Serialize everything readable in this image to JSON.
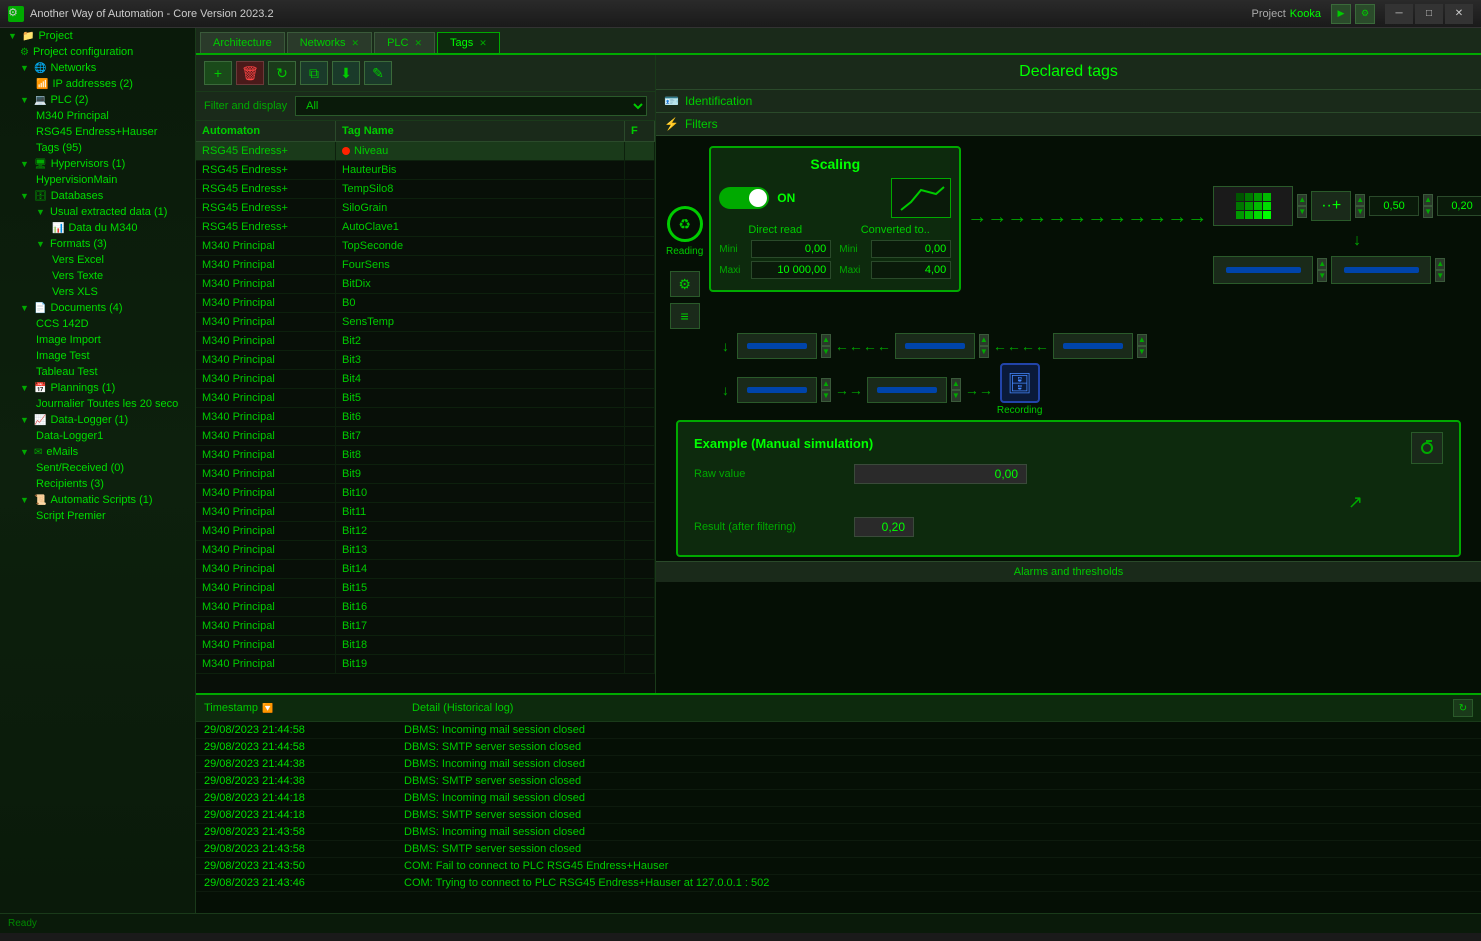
{
  "app": {
    "title": "Another Way of Automation - Core Version 2023.2",
    "project_label": "Project",
    "project_name": "Kooka"
  },
  "tabs": [
    {
      "label": "Architecture",
      "closable": false,
      "active": false
    },
    {
      "label": "Networks",
      "closable": true,
      "active": false
    },
    {
      "label": "PLC",
      "closable": true,
      "active": false
    },
    {
      "label": "Tags",
      "closable": true,
      "active": true
    }
  ],
  "declared_tags": {
    "title": "Declared tags",
    "identification_label": "Identification",
    "filters_label": "Filters",
    "alarms_label": "Alarms and thresholds"
  },
  "filter_bar": {
    "label": "Filter and display",
    "value": "All"
  },
  "tag_table": {
    "headers": [
      "Automaton",
      "Tag Name",
      "F"
    ],
    "rows": [
      {
        "automaton": "RSG45 Endress+",
        "tag_name": "Niveau",
        "flag": "red",
        "selected": true
      },
      {
        "automaton": "RSG45 Endress+",
        "tag_name": "HauteurBis",
        "flag": ""
      },
      {
        "automaton": "RSG45 Endress+",
        "tag_name": "TempSilo8",
        "flag": ""
      },
      {
        "automaton": "RSG45 Endress+",
        "tag_name": "SiloGrain",
        "flag": ""
      },
      {
        "automaton": "RSG45 Endress+",
        "tag_name": "AutoClave1",
        "flag": ""
      },
      {
        "automaton": "M340 Principal",
        "tag_name": "TopSeconde",
        "flag": ""
      },
      {
        "automaton": "M340 Principal",
        "tag_name": "FourSens",
        "flag": ""
      },
      {
        "automaton": "M340 Principal",
        "tag_name": "BitDix",
        "flag": ""
      },
      {
        "automaton": "M340 Principal",
        "tag_name": "B0",
        "flag": ""
      },
      {
        "automaton": "M340 Principal",
        "tag_name": "SensTemp",
        "flag": ""
      },
      {
        "automaton": "M340 Principal",
        "tag_name": "Bit2",
        "flag": ""
      },
      {
        "automaton": "M340 Principal",
        "tag_name": "Bit3",
        "flag": ""
      },
      {
        "automaton": "M340 Principal",
        "tag_name": "Bit4",
        "flag": ""
      },
      {
        "automaton": "M340 Principal",
        "tag_name": "Bit5",
        "flag": ""
      },
      {
        "automaton": "M340 Principal",
        "tag_name": "Bit6",
        "flag": ""
      },
      {
        "automaton": "M340 Principal",
        "tag_name": "Bit7",
        "flag": ""
      },
      {
        "automaton": "M340 Principal",
        "tag_name": "Bit8",
        "flag": ""
      },
      {
        "automaton": "M340 Principal",
        "tag_name": "Bit9",
        "flag": ""
      },
      {
        "automaton": "M340 Principal",
        "tag_name": "Bit10",
        "flag": ""
      },
      {
        "automaton": "M340 Principal",
        "tag_name": "Bit11",
        "flag": ""
      },
      {
        "automaton": "M340 Principal",
        "tag_name": "Bit12",
        "flag": ""
      },
      {
        "automaton": "M340 Principal",
        "tag_name": "Bit13",
        "flag": ""
      },
      {
        "automaton": "M340 Principal",
        "tag_name": "Bit14",
        "flag": ""
      },
      {
        "automaton": "M340 Principal",
        "tag_name": "Bit15",
        "flag": ""
      },
      {
        "automaton": "M340 Principal",
        "tag_name": "Bit16",
        "flag": ""
      },
      {
        "automaton": "M340 Principal",
        "tag_name": "Bit17",
        "flag": ""
      },
      {
        "automaton": "M340 Principal",
        "tag_name": "Bit18",
        "flag": ""
      },
      {
        "automaton": "M340 Principal",
        "tag_name": "Bit19",
        "flag": ""
      }
    ]
  },
  "sidebar": {
    "items": [
      {
        "label": "Project",
        "level": 0,
        "icon": "folder",
        "expanded": true
      },
      {
        "label": "Project configuration",
        "level": 1,
        "icon": "gear"
      },
      {
        "label": "Networks",
        "level": 1,
        "icon": "network",
        "expanded": true
      },
      {
        "label": "IP addresses (2)",
        "level": 2,
        "icon": "ip"
      },
      {
        "label": "PLC (2)",
        "level": 1,
        "icon": "plc",
        "expanded": true
      },
      {
        "label": "M340 Principal",
        "level": 2,
        "icon": "plc-item"
      },
      {
        "label": "RSG45 Endress+Hauser",
        "level": 2,
        "icon": "plc-item"
      },
      {
        "label": "Tags (95)",
        "level": 2,
        "icon": "tags"
      },
      {
        "label": "Hypervisors (1)",
        "level": 1,
        "icon": "hypervisor",
        "expanded": true
      },
      {
        "label": "HypervisionMain",
        "level": 2,
        "icon": "hyper-item"
      },
      {
        "label": "Databases",
        "level": 1,
        "icon": "db",
        "expanded": true
      },
      {
        "label": "Usual extracted data (1)",
        "level": 2,
        "icon": "db-item"
      },
      {
        "label": "Data du M340",
        "level": 3,
        "icon": "table"
      },
      {
        "label": "Formats (3)",
        "level": 2,
        "icon": "format",
        "expanded": true
      },
      {
        "label": "Vers Excel",
        "level": 3,
        "icon": "excel"
      },
      {
        "label": "Vers Texte",
        "level": 3,
        "icon": "text"
      },
      {
        "label": "Vers XLS",
        "level": 3,
        "icon": "xls"
      },
      {
        "label": "Documents (4)",
        "level": 1,
        "icon": "docs",
        "expanded": true
      },
      {
        "label": "CCS 142D",
        "level": 2,
        "icon": "doc"
      },
      {
        "label": "Image Import",
        "level": 2,
        "icon": "img"
      },
      {
        "label": "Image Test",
        "level": 2,
        "icon": "img"
      },
      {
        "label": "Tableau Test",
        "level": 2,
        "icon": "doc"
      },
      {
        "label": "Plannings (1)",
        "level": 1,
        "icon": "plan",
        "expanded": true
      },
      {
        "label": "Journalier Toutes les 20 seco",
        "level": 2,
        "icon": "sched"
      },
      {
        "label": "Data-Logger (1)",
        "level": 1,
        "icon": "logger",
        "expanded": true
      },
      {
        "label": "Data-Logger1",
        "level": 2,
        "icon": "logger-item"
      },
      {
        "label": "eMails",
        "level": 1,
        "icon": "email",
        "expanded": true
      },
      {
        "label": "Sent/Received (0)",
        "level": 2,
        "icon": "sent"
      },
      {
        "label": "Recipients (3)",
        "level": 2,
        "icon": "recip"
      },
      {
        "label": "Automatic Scripts (1)",
        "level": 1,
        "icon": "script",
        "expanded": true
      },
      {
        "label": "Script Premier",
        "level": 2,
        "icon": "script-item"
      }
    ]
  },
  "scaling": {
    "title": "Scaling",
    "on_label": "ON",
    "direct_read_label": "Direct read",
    "converted_label": "Converted to..",
    "mini_label": "Mini",
    "maxi_label": "Maxi",
    "direct_mini": "0,00",
    "direct_maxi": "10 000,00",
    "converted_mini": "0,00",
    "converted_maxi": "4,00"
  },
  "filter_values": {
    "top_right_val": "0,50",
    "top_right_val2": "0,20",
    "reading_label": "Reading"
  },
  "example": {
    "title": "Example (Manual simulation)",
    "raw_value_label": "Raw value",
    "raw_value": "0,00",
    "result_label": "Result (after filtering)",
    "result_value": "0,20"
  },
  "log_panel": {
    "timestamp_label": "Timestamp",
    "detail_label": "Detail (Historical log)",
    "rows": [
      {
        "timestamp": "29/08/2023 21:44:58",
        "detail": "DBMS: Incoming mail session closed"
      },
      {
        "timestamp": "29/08/2023 21:44:58",
        "detail": "DBMS: SMTP server session closed"
      },
      {
        "timestamp": "29/08/2023 21:44:38",
        "detail": "DBMS: Incoming mail session closed"
      },
      {
        "timestamp": "29/08/2023 21:44:38",
        "detail": "DBMS: SMTP server session closed"
      },
      {
        "timestamp": "29/08/2023 21:44:18",
        "detail": "DBMS: Incoming mail session closed"
      },
      {
        "timestamp": "29/08/2023 21:44:18",
        "detail": "DBMS: SMTP server session closed"
      },
      {
        "timestamp": "29/08/2023 21:43:58",
        "detail": "DBMS: Incoming mail session closed"
      },
      {
        "timestamp": "29/08/2023 21:43:58",
        "detail": "DBMS: SMTP server session closed"
      },
      {
        "timestamp": "29/08/2023 21:43:50",
        "detail": "COM: Fail to connect to PLC RSG45 Endress+Hauser"
      },
      {
        "timestamp": "29/08/2023 21:43:46",
        "detail": "COM: Trying to connect to PLC RSG45 Endress+Hauser at 127.0.0.1 : 502"
      }
    ]
  }
}
